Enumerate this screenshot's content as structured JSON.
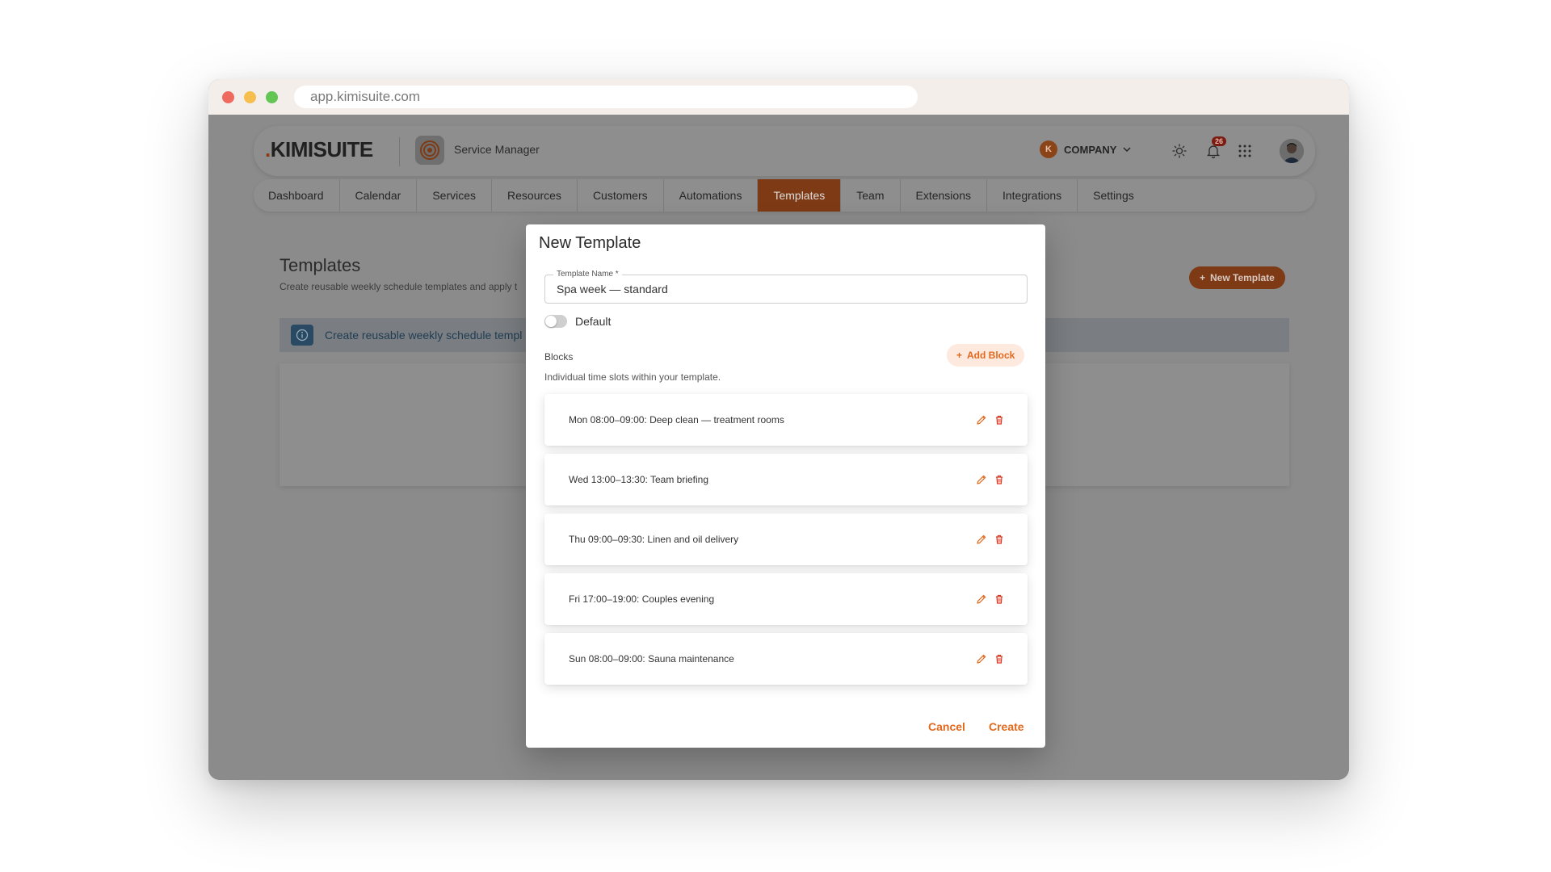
{
  "browser": {
    "url": "app.kimisuite.com"
  },
  "header": {
    "logo_dot": ".",
    "logo_text": "KIMISUITE",
    "app_name": "Service Manager",
    "company_initial": "K",
    "company_label": "COMPANY",
    "notifications_count": "26"
  },
  "nav": {
    "tabs": [
      {
        "label": "Dashboard"
      },
      {
        "label": "Calendar"
      },
      {
        "label": "Services"
      },
      {
        "label": "Resources"
      },
      {
        "label": "Customers"
      },
      {
        "label": "Automations"
      },
      {
        "label": "Templates",
        "active": true
      },
      {
        "label": "Team"
      },
      {
        "label": "Extensions"
      },
      {
        "label": "Integrations"
      },
      {
        "label": "Settings"
      }
    ]
  },
  "page": {
    "title": "Templates",
    "subtitle": "Create reusable weekly schedule templates and apply t",
    "new_template_label": "New Template",
    "info_text": "Create reusable weekly schedule templ"
  },
  "modal": {
    "title": "New Template",
    "template_name_label": "Template Name *",
    "template_name_value": "Spa week — standard",
    "default_label": "Default",
    "blocks_title": "Blocks",
    "blocks_subtitle": "Individual time slots within your template.",
    "add_block_label": "Add Block",
    "blocks": [
      {
        "text": "Mon 08:00–09:00: Deep clean — treatment rooms"
      },
      {
        "text": "Wed 13:00–13:30: Team briefing"
      },
      {
        "text": "Thu 09:00–09:30: Linen and oil delivery"
      },
      {
        "text": "Fri 17:00–19:00: Couples evening"
      },
      {
        "text": "Sun 08:00–09:00: Sauna maintenance"
      }
    ],
    "cancel_label": "Cancel",
    "create_label": "Create"
  },
  "colors": {
    "accent": "#e0691f",
    "active_tab": "#7d3a14"
  }
}
